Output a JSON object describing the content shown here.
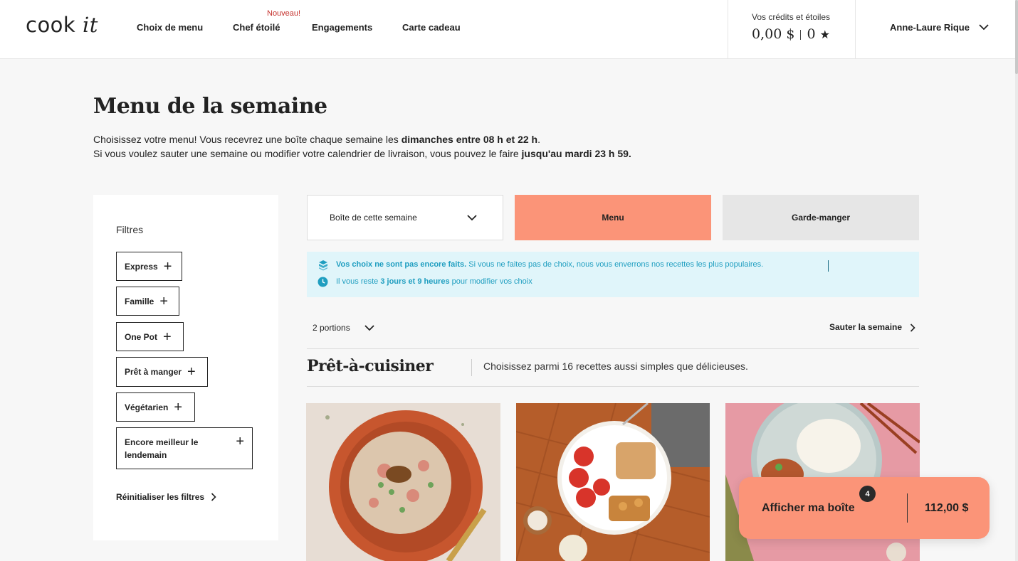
{
  "header": {
    "logo_main": "cook",
    "logo_accent": "it",
    "nav": [
      "Choix de menu",
      "Chef étoilé",
      "Engagements",
      "Carte cadeau"
    ],
    "new_badge": "Nouveau!",
    "credits_label": "Vos crédits et étoiles",
    "credits_amount": "0,00 $",
    "stars_count": "0",
    "star_glyph": "★",
    "user_name": "Anne-Laure Rique"
  },
  "page": {
    "title": "Menu de la semaine",
    "intro_line1_a": "Choisissez votre menu! Vous recevrez une boîte chaque semaine les ",
    "intro_line1_b": "dimanches entre 08 h et 22 h",
    "intro_line1_c": ".",
    "intro_line2_a": "Si vous voulez sauter une semaine ou modifier votre calendrier de livraison, vous pouvez le faire ",
    "intro_line2_b": "jusqu'au mardi 23 h 59."
  },
  "filters": {
    "title": "Filtres",
    "chips": [
      {
        "label": "Express"
      },
      {
        "label": "Famille"
      },
      {
        "label": "One Pot"
      },
      {
        "label": "Prêt à manger"
      },
      {
        "label": "Végétarien"
      },
      {
        "label": "Encore meilleur le lendemain"
      }
    ],
    "plus_glyph": "+",
    "reset": "Réinitialiser les filtres"
  },
  "toolbar": {
    "week_select": "Boîte de cette semaine",
    "tab_menu": "Menu",
    "tab_pantry": "Garde-manger"
  },
  "info": {
    "line1_bold": "Vos choix ne sont pas encore faits.",
    "line1_rest": " Si vous ne faites pas de choix, nous vous enverrons nos recettes les plus populaires.",
    "line2_a": "Il vous reste ",
    "line2_bold": "3 jours et 9 heures",
    "line2_b": " pour modifier vos choix"
  },
  "options": {
    "portions": "2 portions",
    "skip": "Sauter la semaine"
  },
  "section": {
    "title": "Prêt-à-cuisiner",
    "subtitle": "Choisissez parmi 16 recettes aussi simples que délicieuses."
  },
  "cart": {
    "label": "Afficher ma boîte",
    "count": "4",
    "price": "112,00 $"
  },
  "colors": {
    "accent": "#fb9478",
    "info_bg": "#e0f5fa",
    "info_text": "#1f9ec0"
  },
  "icons": [
    "chevron-down-icon",
    "chevron-right-icon",
    "plus-icon",
    "box-icon",
    "clock-icon",
    "star-icon"
  ]
}
